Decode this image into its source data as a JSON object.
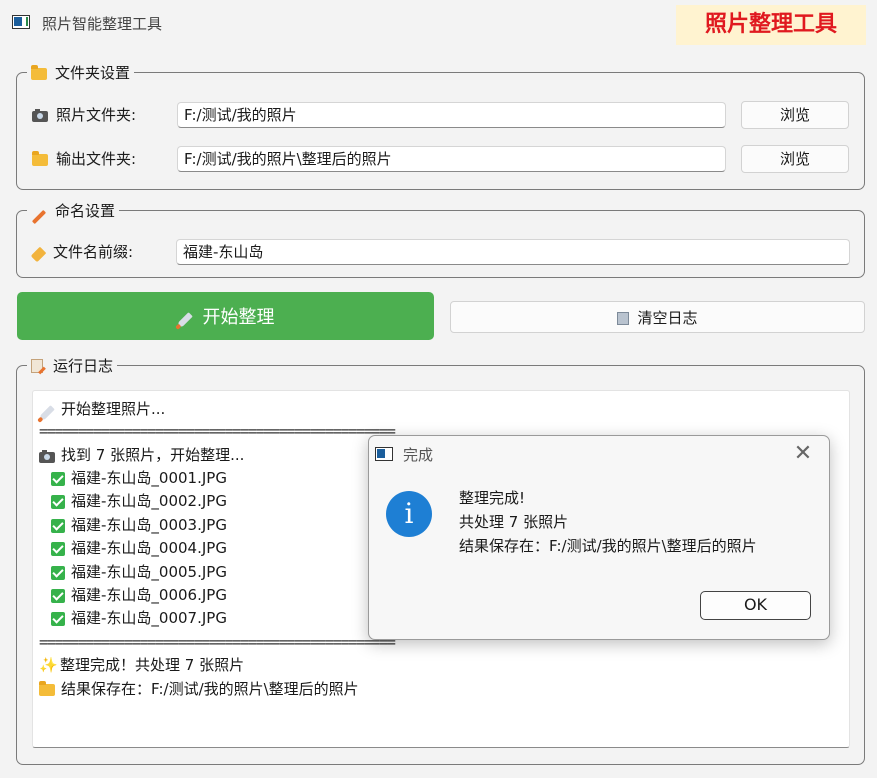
{
  "window": {
    "title": "照片智能整理工具",
    "brand": "照片整理工具"
  },
  "folder_settings": {
    "legend": "文件夹设置",
    "photo_label": "照片文件夹:",
    "photo_value": "F:/测试/我的照片",
    "output_label": "输出文件夹:",
    "output_value": "F:/测试/我的照片\\整理后的照片",
    "browse_label": "浏览"
  },
  "naming_settings": {
    "legend": "命名设置",
    "prefix_label": "文件名前缀:",
    "prefix_value": "福建-东山岛"
  },
  "actions": {
    "start_label": "开始整理",
    "clear_label": "清空日志"
  },
  "log": {
    "legend": "运行日志",
    "start_line": "开始整理照片...",
    "separator": "==============================================",
    "found_line": "找到 7 张照片，开始整理...",
    "files": [
      "福建-东山岛_0001.JPG",
      "福建-东山岛_0002.JPG",
      "福建-东山岛_0003.JPG",
      "福建-东山岛_0004.JPG",
      "福建-东山岛_0005.JPG",
      "福建-东山岛_0006.JPG",
      "福建-东山岛_0007.JPG"
    ],
    "done_line": "整理完成！共处理 7 张照片",
    "saved_line": "结果保存在：F:/测试/我的照片\\整理后的照片"
  },
  "dialog": {
    "title": "完成",
    "line1": "整理完成!",
    "line2": "共处理 7 张照片",
    "line3": "结果保存在：F:/测试/我的照片\\整理后的照片",
    "ok_label": "OK",
    "close_glyph": "✕",
    "info_glyph": "i"
  },
  "colors": {
    "start_button": "#4caf50",
    "brand_text": "#e0191f",
    "brand_bg": "#fff3d0",
    "info_icon": "#1e7fd4"
  }
}
